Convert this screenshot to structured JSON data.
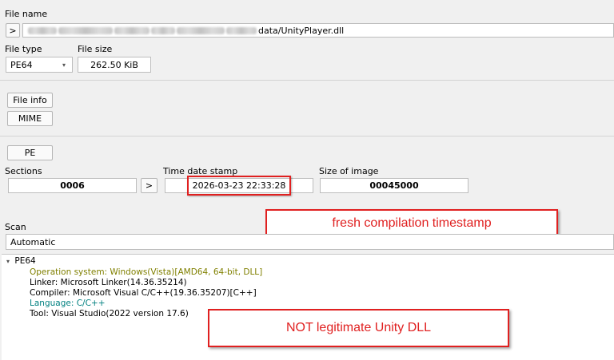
{
  "file_name": {
    "label": "File name",
    "browse_button": ">",
    "path_visible_suffix": "data/UnityPlayer.dll"
  },
  "file_type": {
    "label": "File type",
    "value": "PE64"
  },
  "file_size": {
    "label": "File size",
    "value": "262.50 KiB"
  },
  "buttons": {
    "file_info": "File info",
    "mime": "MIME",
    "pe": "PE"
  },
  "pe_info": {
    "sections_label": "Sections",
    "sections_value": "0006",
    "sections_button": ">",
    "timestamp_label": "Time date stamp",
    "timestamp_value": "2026-03-23 22:33:28",
    "size_of_image_label": "Size of image",
    "size_of_image_value": "00045000"
  },
  "scan": {
    "label": "Scan",
    "mode": "Automatic"
  },
  "results": {
    "root": "PE64",
    "items": [
      {
        "text": "Operation system: Windows(Vista)[AMD64, 64-bit, DLL]",
        "color": "#808000"
      },
      {
        "text": "Linker: Microsoft Linker(14.36.35214)",
        "color": "#000000"
      },
      {
        "text": "Compiler: Microsoft Visual C/C++(19.36.35207)[C++]",
        "color": "#000000"
      },
      {
        "text": "Language: C/C++",
        "color": "#008080"
      },
      {
        "text": "Tool: Visual Studio(2022 version 17.6)",
        "color": "#000000"
      }
    ]
  },
  "annotations": {
    "timestamp_note": "fresh compilation timestamp",
    "legit_note": "NOT legitimate Unity DLL",
    "color": "#e02020"
  }
}
